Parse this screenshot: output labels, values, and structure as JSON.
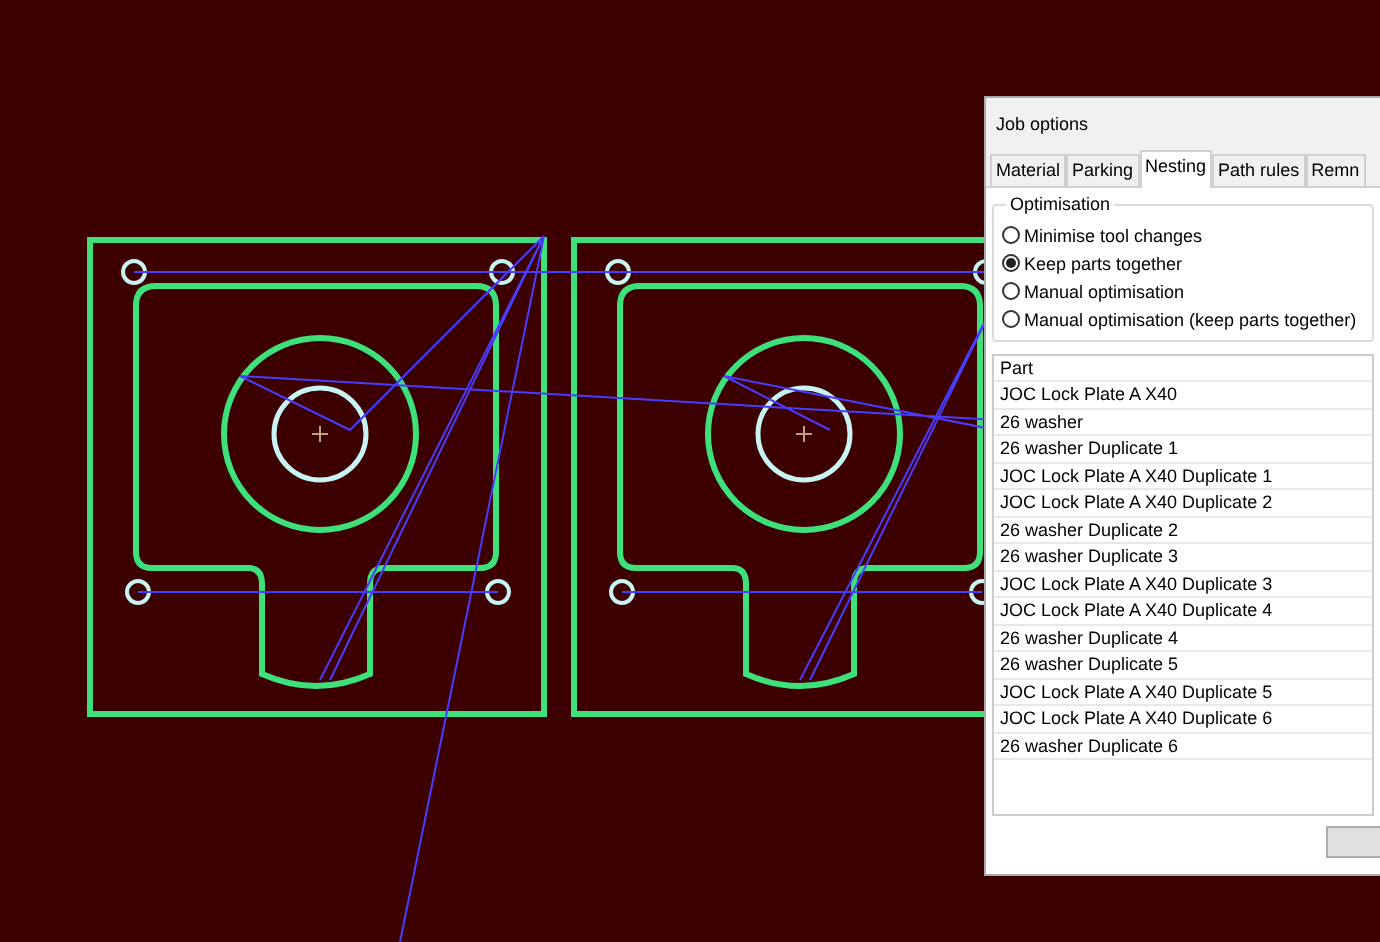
{
  "window": {
    "title": "Job options"
  },
  "tabs": [
    {
      "label": "Material",
      "selected": false
    },
    {
      "label": "Parking",
      "selected": false
    },
    {
      "label": "Nesting",
      "selected": true
    },
    {
      "label": "Path rules",
      "selected": false
    },
    {
      "label": "Remn",
      "selected": false
    }
  ],
  "optimisation": {
    "title": "Optimisation",
    "options": [
      {
        "label": "Minimise tool changes",
        "selected": false
      },
      {
        "label": "Keep parts together",
        "selected": true
      },
      {
        "label": "Manual optimisation",
        "selected": false
      },
      {
        "label": "Manual optimisation (keep parts together)",
        "selected": false
      }
    ]
  },
  "parts_table": {
    "columns": [
      "Part"
    ],
    "rows": [
      "JOC Lock Plate A X40",
      "26 washer",
      "26 washer Duplicate 1",
      "JOC Lock Plate A X40 Duplicate 1",
      "JOC Lock Plate A X40 Duplicate 2",
      "26 washer Duplicate 2",
      "26 washer Duplicate 3",
      "JOC Lock Plate A X40 Duplicate 3",
      "JOC Lock Plate A X40 Duplicate 4",
      "26 washer Duplicate 4",
      "26 washer Duplicate 5",
      "JOC Lock Plate A X40 Duplicate 5",
      "JOC Lock Plate A X40 Duplicate 6",
      "26 washer Duplicate 6"
    ]
  }
}
